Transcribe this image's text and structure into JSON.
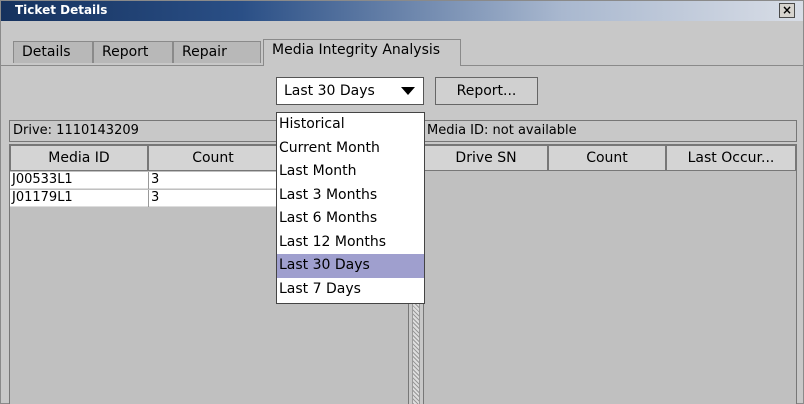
{
  "window": {
    "title": "Ticket Details",
    "close_label": "×"
  },
  "tabs": [
    {
      "label": "Details"
    },
    {
      "label": "Report"
    },
    {
      "label": "Repair"
    },
    {
      "label": "Media Integrity Analysis",
      "active": true
    }
  ],
  "toolbar": {
    "range_selected": "Last 30 Days",
    "report_button": "Report..."
  },
  "dropdown": {
    "options": [
      "Historical",
      "Current Month",
      "Last Month",
      "Last 3 Months",
      "Last 6 Months",
      "Last 12 Months",
      "Last 30 Days",
      "Last 7 Days"
    ],
    "selected_index": 6
  },
  "left_panel": {
    "label": "Drive: 1110143209",
    "columns": [
      "Media ID",
      "Count"
    ],
    "rows": [
      {
        "media_id": "J00533L1",
        "count": "3"
      },
      {
        "media_id": "J01179L1",
        "count": "3"
      }
    ]
  },
  "right_panel": {
    "label": "Media ID: not available",
    "columns": [
      "Drive SN",
      "Count",
      "Last Occur..."
    ]
  },
  "colors": {
    "selection": "#9f9fce",
    "title_start": "#16325e"
  }
}
